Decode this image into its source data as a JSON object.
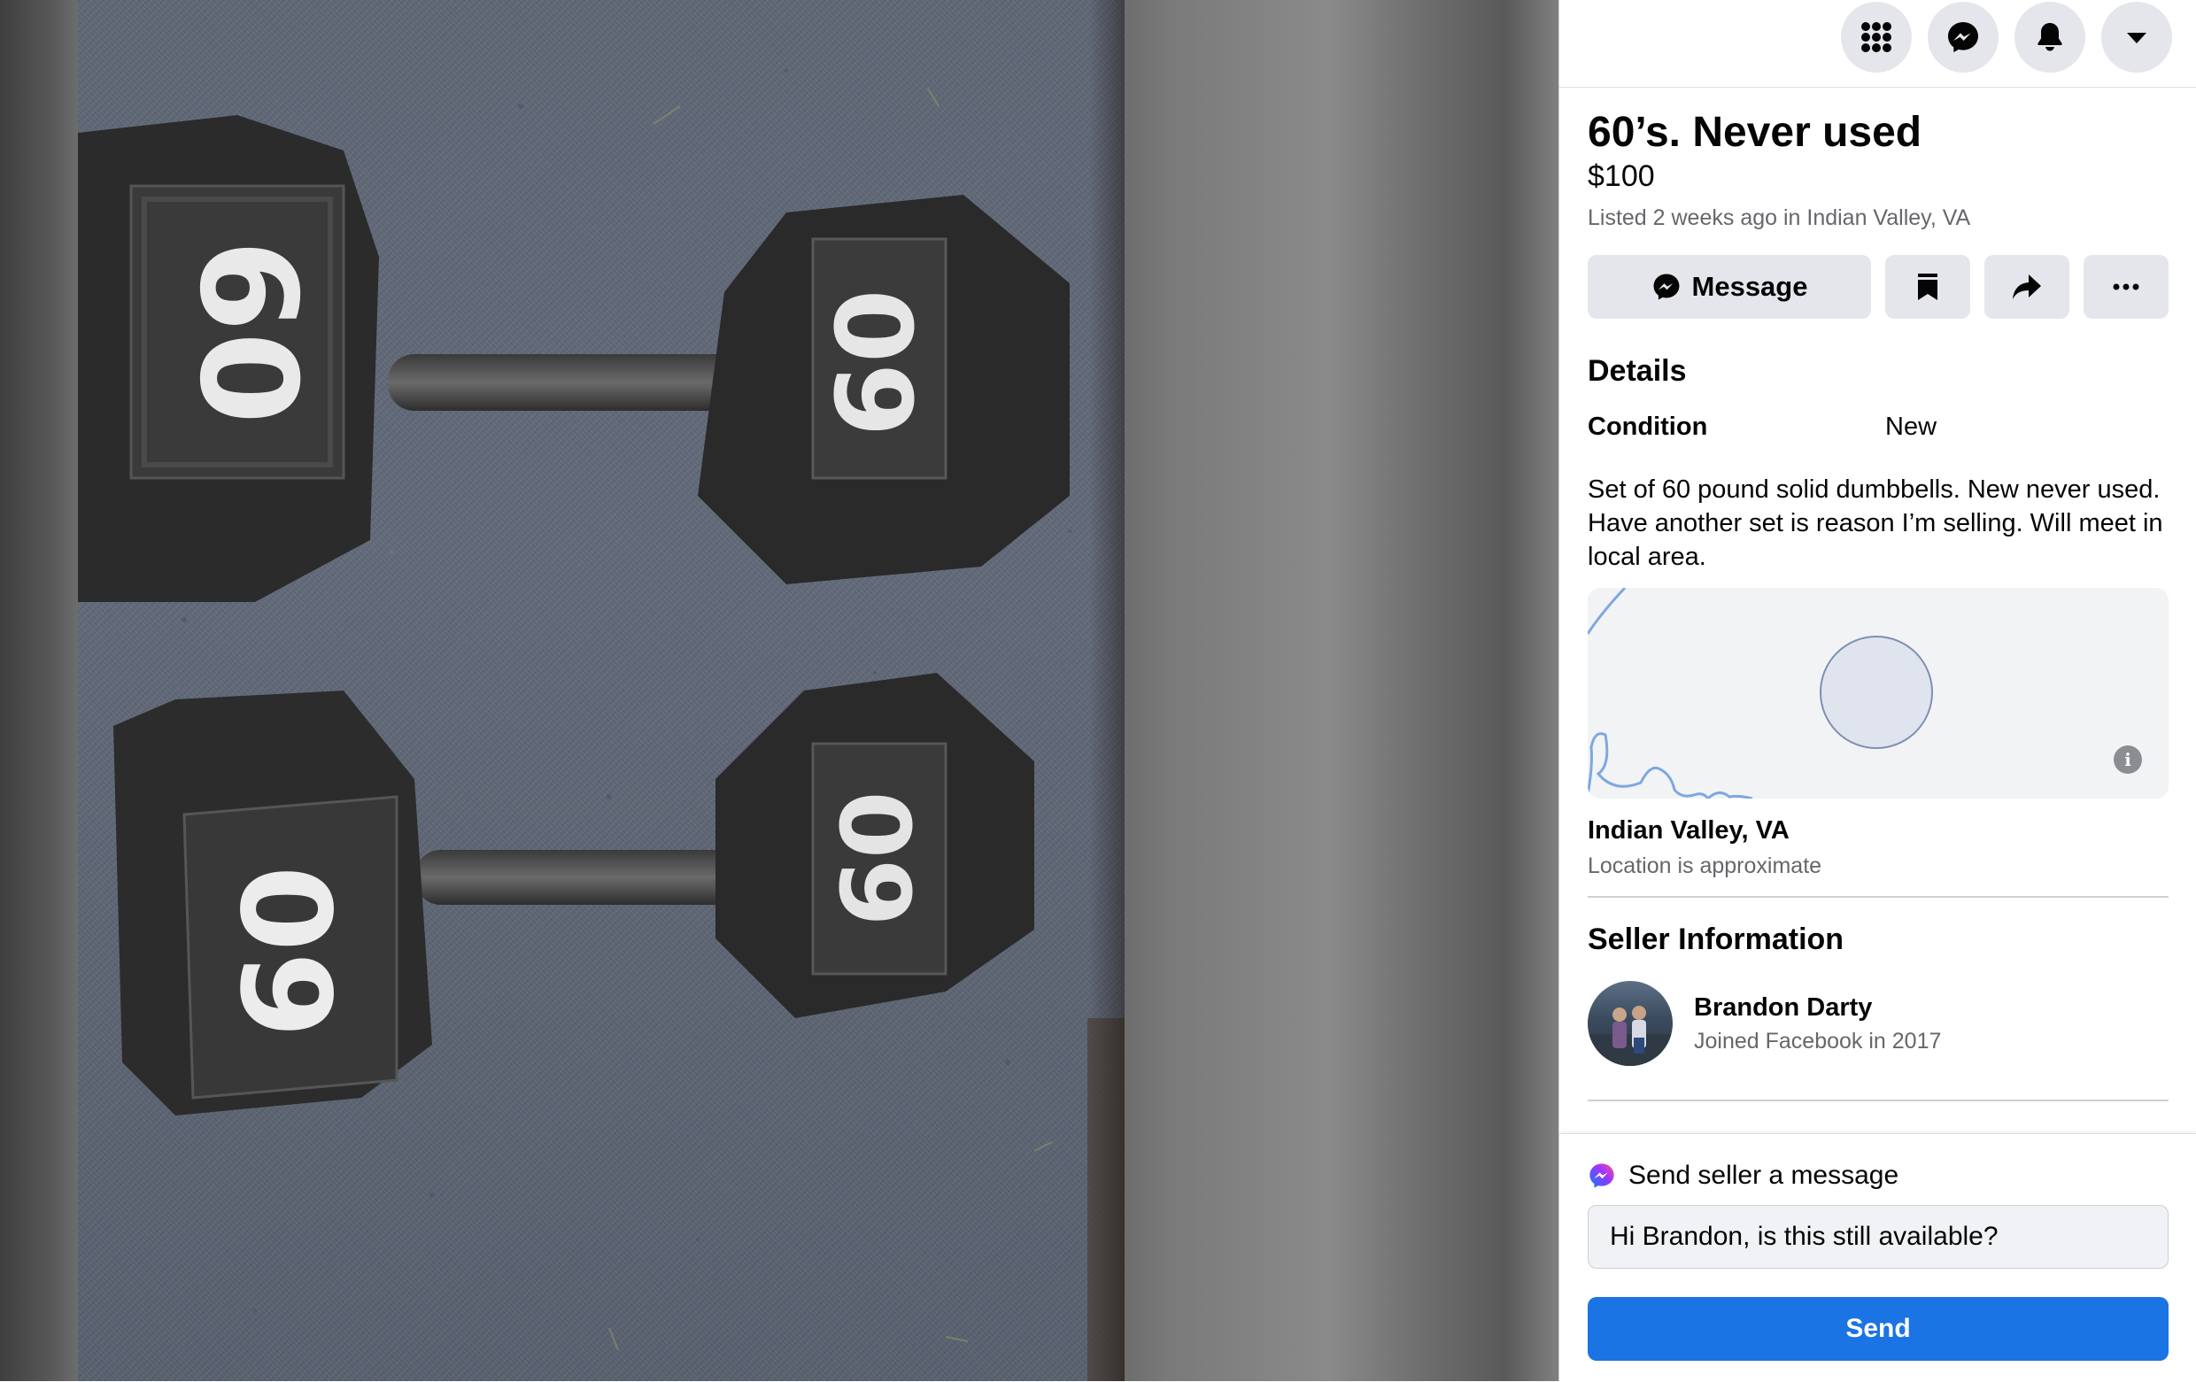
{
  "topbar": {
    "icons": [
      "menu-grid-icon",
      "messenger-icon",
      "notifications-bell-icon",
      "account-dropdown-icon"
    ]
  },
  "listing": {
    "title": "60’s. Never used",
    "price": "$100",
    "listed": "Listed 2 weeks ago in Indian Valley, VA",
    "actions": {
      "message_label": "Message"
    }
  },
  "details": {
    "heading": "Details",
    "condition_label": "Condition",
    "condition_value": "New",
    "description": "Set of 60 pound solid dumbbells. New never used. Have another set is reason I’m selling. Will meet in local area."
  },
  "location": {
    "name": "Indian Valley, VA",
    "note": "Location is approximate",
    "info_glyph": "i"
  },
  "seller": {
    "heading": "Seller Information",
    "name": "Brandon Darty",
    "joined": "Joined Facebook in 2017"
  },
  "compose": {
    "heading": "Send seller a message",
    "input_value": "Hi Brandon, is this still available?",
    "send_label": "Send"
  },
  "photo": {
    "weight_marking": "60"
  },
  "colors": {
    "accent": "#1b74e4",
    "button_bg": "#e4e6eb",
    "secondary_text": "#65676b",
    "map_bg": "#f2f3f5",
    "river": "#7fa7e0"
  }
}
